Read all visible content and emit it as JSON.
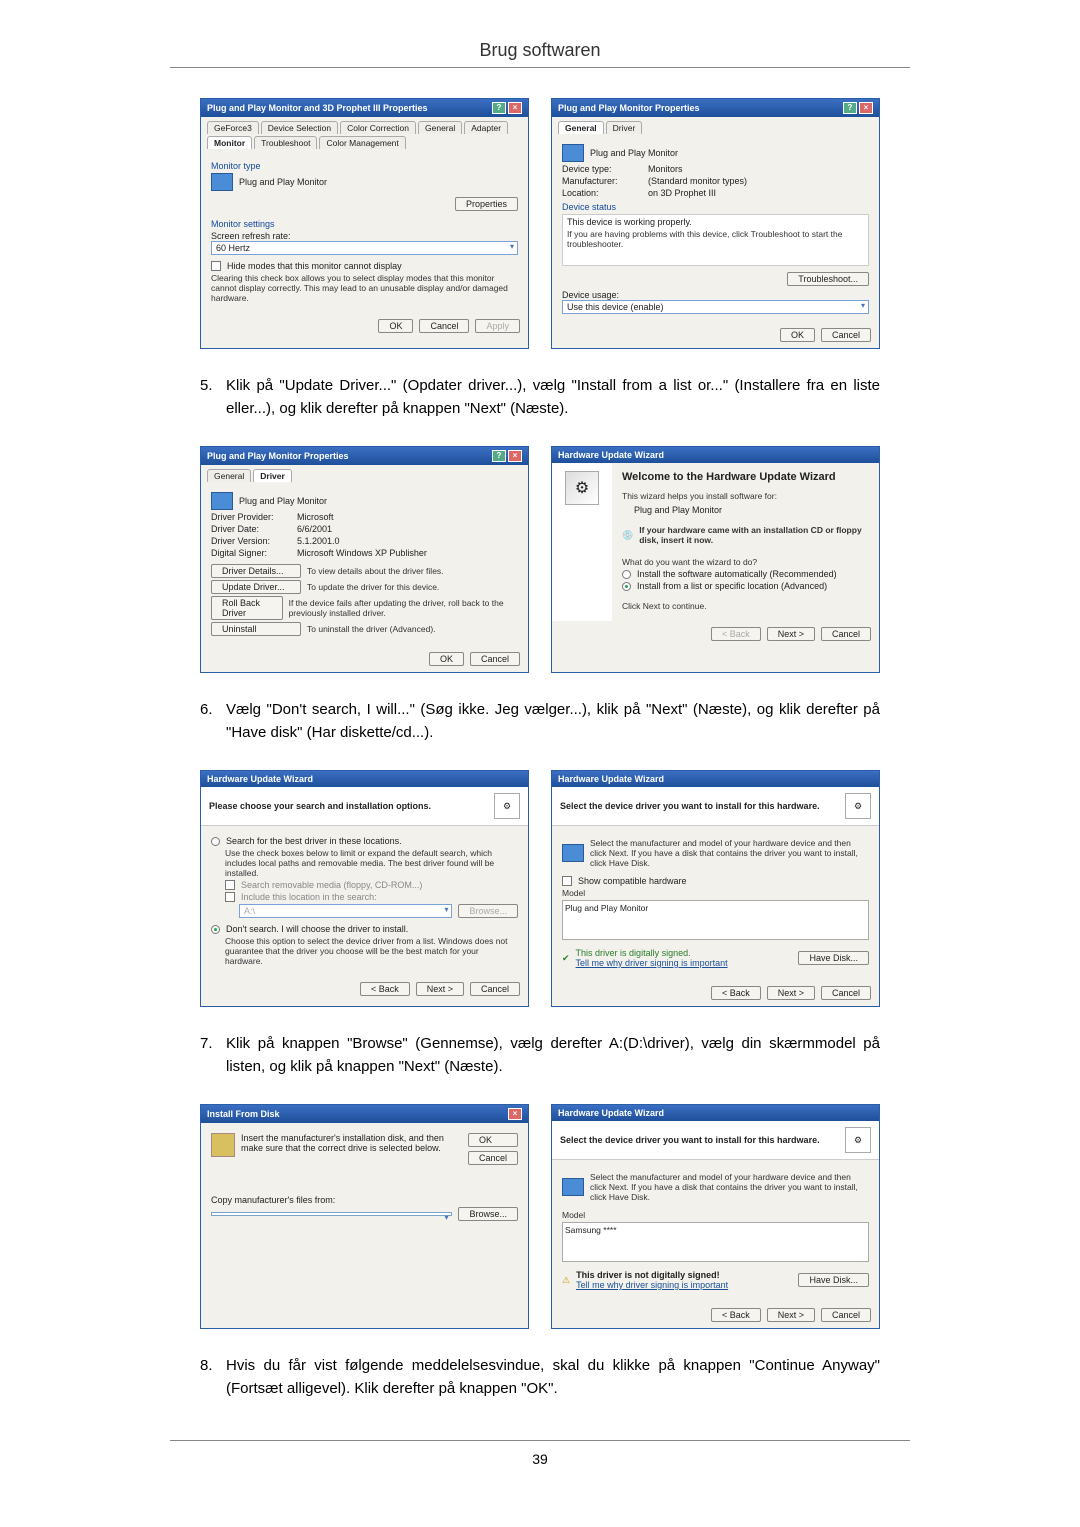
{
  "page": {
    "title": "Brug softwaren",
    "number": "39"
  },
  "steps": {
    "s5": "Klik på \"Update Driver...\" (Opdater driver...), vælg \"Install from a list or...\" (Installere fra en liste eller...), og klik derefter på knappen \"Next\" (Næste).",
    "s6": "Vælg \"Don't search, I will...\" (Søg ikke. Jeg vælger...), klik på \"Next\" (Næste), og klik derefter på \"Have disk\" (Har diskette/cd...).",
    "s7": "Klik på knappen \"Browse\" (Gennemse), vælg derefter A:(D:\\driver), vælg din skærmmodel på listen, og klik på knappen \"Next\" (Næste).",
    "s8": "Hvis du får vist følgende meddelelsesvindue, skal du klikke på knappen \"Continue Anyway\" (Fortsæt alligevel). Klik derefter på knappen \"OK\"."
  },
  "common": {
    "ok": "OK",
    "cancel": "Cancel",
    "apply": "Apply",
    "back": "< Back",
    "next": "Next >",
    "browse": "Browse...",
    "have_disk": "Have Disk..."
  },
  "dlg1": {
    "title": "Plug and Play Monitor and 3D Prophet III Properties",
    "tabs": {
      "geforce": "GeForce3",
      "devsel": "Device Selection",
      "colorcorr": "Color Correction",
      "general": "General",
      "adapter": "Adapter",
      "monitor": "Monitor",
      "trouble": "Troubleshoot",
      "colormgmt": "Color Management"
    },
    "monitor_type_lbl": "Monitor type",
    "monitor_type_val": "Plug and Play Monitor",
    "properties_btn": "Properties",
    "settings_lbl": "Monitor settings",
    "refresh_lbl": "Screen refresh rate:",
    "refresh_val": "60 Hertz",
    "hide_chk": "Hide modes that this monitor cannot display",
    "hide_note": "Clearing this check box allows you to select display modes that this monitor cannot display correctly. This may lead to an unusable display and/or damaged hardware."
  },
  "dlg2": {
    "title": "Plug and Play Monitor Properties",
    "tab_general": "General",
    "tab_driver": "Driver",
    "name": "Plug and Play Monitor",
    "devtype_k": "Device type:",
    "devtype_v": "Monitors",
    "manu_k": "Manufacturer:",
    "manu_v": "(Standard monitor types)",
    "loc_k": "Location:",
    "loc_v": "on 3D Prophet III",
    "status_lbl": "Device status",
    "status_txt": "This device is working properly.",
    "status_help": "If you are having problems with this device, click Troubleshoot to start the troubleshooter.",
    "troubleshoot_btn": "Troubleshoot...",
    "usage_lbl": "Device usage:",
    "usage_val": "Use this device (enable)"
  },
  "dlg3": {
    "provider_k": "Driver Provider:",
    "provider_v": "Microsoft",
    "date_k": "Driver Date:",
    "date_v": "6/6/2001",
    "ver_k": "Driver Version:",
    "ver_v": "5.1.2001.0",
    "signer_k": "Digital Signer:",
    "signer_v": "Microsoft Windows XP Publisher",
    "details_btn": "Driver Details...",
    "details_txt": "To view details about the driver files.",
    "update_btn": "Update Driver...",
    "update_txt": "To update the driver for this device.",
    "rollback_btn": "Roll Back Driver",
    "rollback_txt": "If the device fails after updating the driver, roll back to the previously installed driver.",
    "uninstall_btn": "Uninstall",
    "uninstall_txt": "To uninstall the driver (Advanced)."
  },
  "dlg4": {
    "title": "Hardware Update Wizard",
    "welcome": "Welcome to the Hardware Update Wizard",
    "helps": "This wizard helps you install software for:",
    "device": "Plug and Play Monitor",
    "cd_hint": "If your hardware came with an installation CD or floppy disk, insert it now.",
    "what": "What do you want the wizard to do?",
    "opt_auto": "Install the software automatically (Recommended)",
    "opt_list": "Install from a list or specific location (Advanced)",
    "cont": "Click Next to continue."
  },
  "dlg5": {
    "banner": "Please choose your search and installation options.",
    "opt_search": "Search for the best driver in these locations.",
    "opt_search_note": "Use the check boxes below to limit or expand the default search, which includes local paths and removable media. The best driver found will be installed.",
    "chk_removable": "Search removable media (floppy, CD-ROM...)",
    "chk_include": "Include this location in the search:",
    "path": "A:\\",
    "opt_dont": "Don't search. I will choose the driver to install.",
    "opt_dont_note": "Choose this option to select the device driver from a list. Windows does not guarantee that the driver you choose will be the best match for your hardware."
  },
  "dlg6": {
    "banner": "Select the device driver you want to install for this hardware.",
    "instr": "Select the manufacturer and model of your hardware device and then click Next. If you have a disk that contains the driver you want to install, click Have Disk.",
    "show_compat": "Show compatible hardware",
    "model_lbl": "Model",
    "model_val": "Plug and Play Monitor",
    "signed": "This driver is digitally signed.",
    "tell": "Tell me why driver signing is important"
  },
  "dlg7": {
    "title": "Install From Disk",
    "instr": "Insert the manufacturer's installation disk, and then make sure that the correct drive is selected below.",
    "copy_lbl": "Copy manufacturer's files from:",
    "path": ""
  },
  "dlg8": {
    "model_val": "Samsung ****",
    "notsigned": "This driver is not digitally signed!",
    "tell": "Tell me why driver signing is important"
  }
}
